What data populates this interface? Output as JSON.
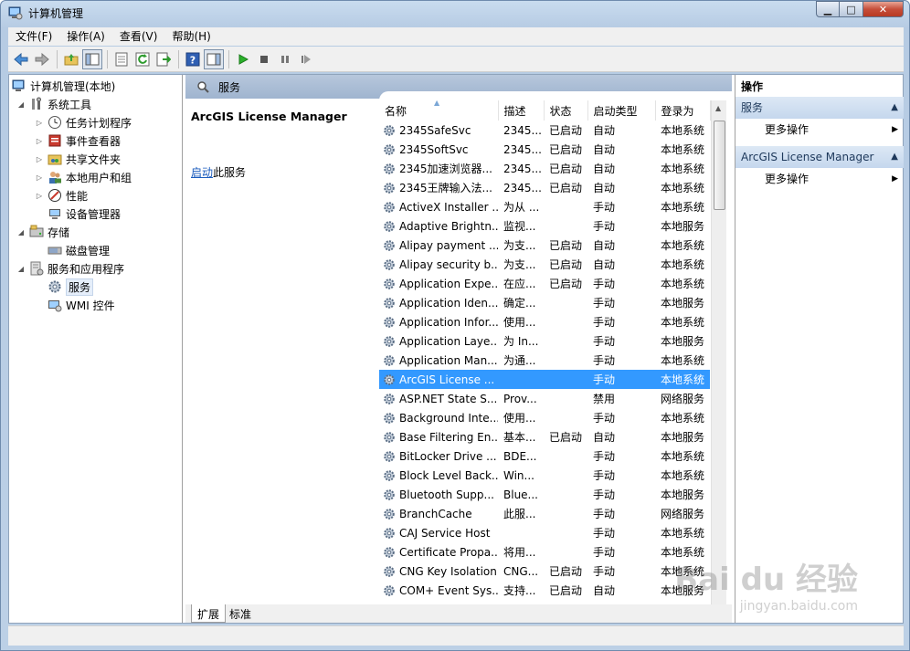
{
  "window": {
    "title": "计算机管理"
  },
  "menu": [
    "文件(F)",
    "操作(A)",
    "查看(V)",
    "帮助(H)"
  ],
  "toolbar": {
    "buttons": [
      "back-icon",
      "forward-icon",
      "up-folder-icon",
      "show-hide-tree-icon",
      "export-icon",
      "refresh-icon",
      "export-list-icon",
      "help-icon",
      "action-pane-icon",
      "start-icon",
      "stop-icon",
      "pause-icon",
      "restart-icon"
    ]
  },
  "tree": {
    "root": "计算机管理(本地)",
    "system_tools": "系统工具",
    "task_scheduler": "任务计划程序",
    "event_viewer": "事件查看器",
    "shared_folders": "共享文件夹",
    "local_users": "本地用户和组",
    "performance": "性能",
    "device_manager": "设备管理器",
    "storage": "存储",
    "disk_management": "磁盘管理",
    "services_apps": "服务和应用程序",
    "services": "服务",
    "wmi": "WMI 控件"
  },
  "center": {
    "header": "服务",
    "selected_service": "ArcGIS License Manager",
    "link_text": "启动",
    "link_suffix": "此服务",
    "columns": [
      "名称",
      "描述",
      "状态",
      "启动类型",
      "登录为"
    ],
    "rows": [
      [
        "2345SafeSvc",
        "2345...",
        "已启动",
        "自动",
        "本地系统"
      ],
      [
        "2345SoftSvc",
        "2345...",
        "已启动",
        "自动",
        "本地系统"
      ],
      [
        "2345加速浏览器...",
        "2345...",
        "已启动",
        "自动",
        "本地系统"
      ],
      [
        "2345王牌输入法...",
        "2345...",
        "已启动",
        "自动",
        "本地系统"
      ],
      [
        "ActiveX Installer ...",
        "为从 ...",
        "",
        "手动",
        "本地系统"
      ],
      [
        "Adaptive Brightn...",
        "监视...",
        "",
        "手动",
        "本地服务"
      ],
      [
        "Alipay payment ...",
        "为支...",
        "已启动",
        "自动",
        "本地系统"
      ],
      [
        "Alipay security b...",
        "为支...",
        "已启动",
        "自动",
        "本地系统"
      ],
      [
        "Application Expe...",
        "在应...",
        "已启动",
        "手动",
        "本地系统"
      ],
      [
        "Application Iden...",
        "确定...",
        "",
        "手动",
        "本地服务"
      ],
      [
        "Application Infor...",
        "使用...",
        "",
        "手动",
        "本地系统"
      ],
      [
        "Application Laye...",
        "为 In...",
        "",
        "手动",
        "本地服务"
      ],
      [
        "Application Man...",
        "为通...",
        "",
        "手动",
        "本地系统"
      ],
      [
        "ArcGIS License ...",
        "",
        "",
        "手动",
        "本地系统"
      ],
      [
        "ASP.NET State S...",
        "Prov...",
        "",
        "禁用",
        "网络服务"
      ],
      [
        "Background Inte...",
        "使用...",
        "",
        "手动",
        "本地系统"
      ],
      [
        "Base Filtering En...",
        "基本...",
        "已启动",
        "自动",
        "本地服务"
      ],
      [
        "BitLocker Drive ...",
        "BDE...",
        "",
        "手动",
        "本地系统"
      ],
      [
        "Block Level Back...",
        "Win...",
        "",
        "手动",
        "本地系统"
      ],
      [
        "Bluetooth Supp...",
        "Blue...",
        "",
        "手动",
        "本地服务"
      ],
      [
        "BranchCache",
        "此服...",
        "",
        "手动",
        "网络服务"
      ],
      [
        "CAJ Service Host",
        "",
        "",
        "手动",
        "本地系统"
      ],
      [
        "Certificate Propa...",
        "将用...",
        "",
        "手动",
        "本地系统"
      ],
      [
        "CNG Key Isolation",
        "CNG...",
        "已启动",
        "手动",
        "本地系统"
      ],
      [
        "COM+ Event Sys...",
        "支持...",
        "已启动",
        "自动",
        "本地服务"
      ]
    ],
    "selected_row": 13,
    "tabs": [
      "扩展",
      "标准"
    ]
  },
  "actions": {
    "header": "操作",
    "sections": [
      {
        "title": "服务",
        "item": "更多操作"
      },
      {
        "title": "ArcGIS License Manager",
        "item": "更多操作"
      }
    ]
  },
  "watermark": {
    "text": "Bai du 经验",
    "sub": "jingyan.baidu.com"
  }
}
